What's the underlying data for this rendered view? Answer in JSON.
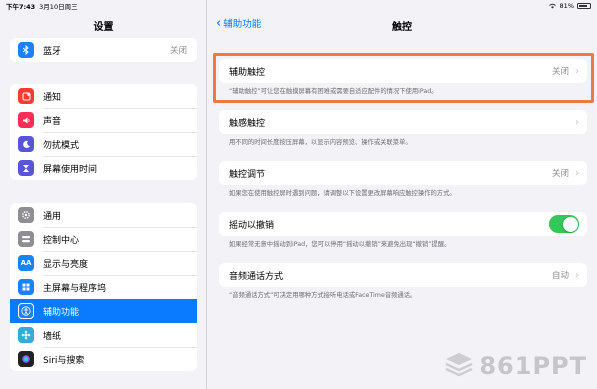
{
  "status": {
    "time": "下午7:43",
    "date": "3月10日周三",
    "battery": "81%"
  },
  "sidebar": {
    "title": "设置",
    "group1": [
      {
        "label": "蓝牙",
        "value": "关闭",
        "icon": "bluetooth-icon",
        "color": "#1a82fb"
      }
    ],
    "group2": [
      {
        "label": "通知",
        "icon": "notifications-icon",
        "color": "#ff3b30"
      },
      {
        "label": "声音",
        "icon": "sound-icon",
        "color": "#ff2d55"
      },
      {
        "label": "勿扰模式",
        "icon": "moon-icon",
        "color": "#5856d6"
      },
      {
        "label": "屏幕使用时间",
        "icon": "hourglass-icon",
        "color": "#5856d6"
      }
    ],
    "group3": [
      {
        "label": "通用",
        "icon": "gear-icon",
        "color": "#8e8e93"
      },
      {
        "label": "控制中心",
        "icon": "control-center-icon",
        "color": "#8e8e93"
      },
      {
        "label": "显示与亮度",
        "icon": "display-icon",
        "color": "#1a82fb"
      },
      {
        "label": "主屏幕与程序坞",
        "icon": "home-screen-icon",
        "color": "#1a82fb"
      },
      {
        "label": "辅助功能",
        "icon": "accessibility-icon",
        "color": "#1a82fb",
        "active": true
      },
      {
        "label": "墙纸",
        "icon": "wallpaper-icon",
        "color": "#35aadc"
      },
      {
        "label": "Siri与搜索",
        "icon": "siri-icon",
        "color": "#222222"
      }
    ]
  },
  "detail": {
    "back_label": "辅助功能",
    "title": "触控",
    "assistive_touch": {
      "label": "辅助触控",
      "value": "关闭",
      "note": "“辅助触控”可让您在触摸屏幕有困难或需要自适应配件的情况下使用iPad。"
    },
    "haptic_touch": {
      "label": "触感触控",
      "note": "用不同的时间长度按压屏幕，以显示内容预览、操作或关联菜单。"
    },
    "touch_accommodations": {
      "label": "触控调节",
      "value": "关闭",
      "note": "如果您在使用触控屏时遇到问题，请调整以下设置更改屏幕响应触控操作的方式。"
    },
    "shake_to_undo": {
      "label": "摇动以撤销",
      "enabled": true,
      "note": "如果经常无意中摇动到iPad，您可以停用“摇动以撤销”来避免出现“撤销”提醒。"
    },
    "call_audio_routing": {
      "label": "音频通话方式",
      "value": "自动",
      "note": "“音频通话方式”可决定用哪种方式接听电话或FaceTime音频通话。"
    }
  },
  "watermark": {
    "text": "861PPT"
  },
  "colors": {
    "accent": "#0a7aff",
    "highlight": "#ef7a3f",
    "toggle_on": "#34c759"
  }
}
